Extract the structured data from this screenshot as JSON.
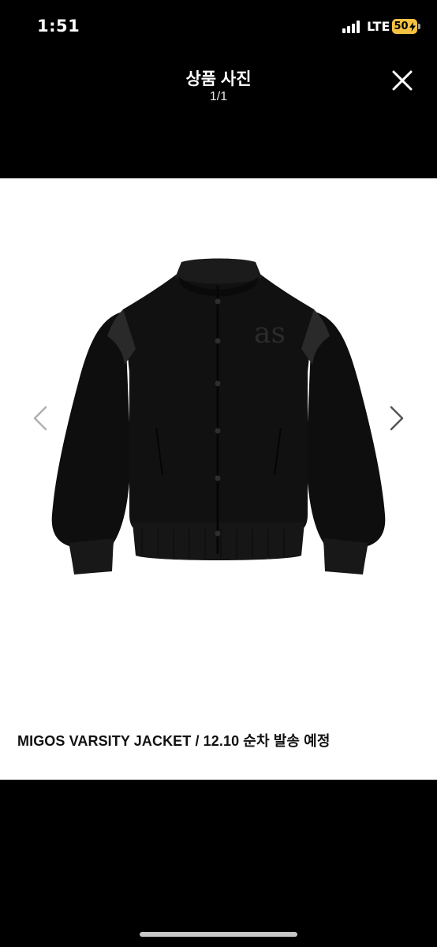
{
  "status_bar": {
    "time": "1:51",
    "network": "LTE",
    "battery_level": "50",
    "battery_color": "#f5c242"
  },
  "header": {
    "title": "상품 사진",
    "counter": "1/1",
    "close_icon": "close-icon"
  },
  "photo": {
    "subject": "black-varsity-jacket",
    "logo_text": "as",
    "prev_icon": "chevron-left-icon",
    "next_icon": "chevron-right-icon",
    "caption": "MIGOS VARSITY JACKET / 12.10 순차 발송 예정"
  },
  "colors": {
    "background": "#000000",
    "panel": "#ffffff"
  }
}
